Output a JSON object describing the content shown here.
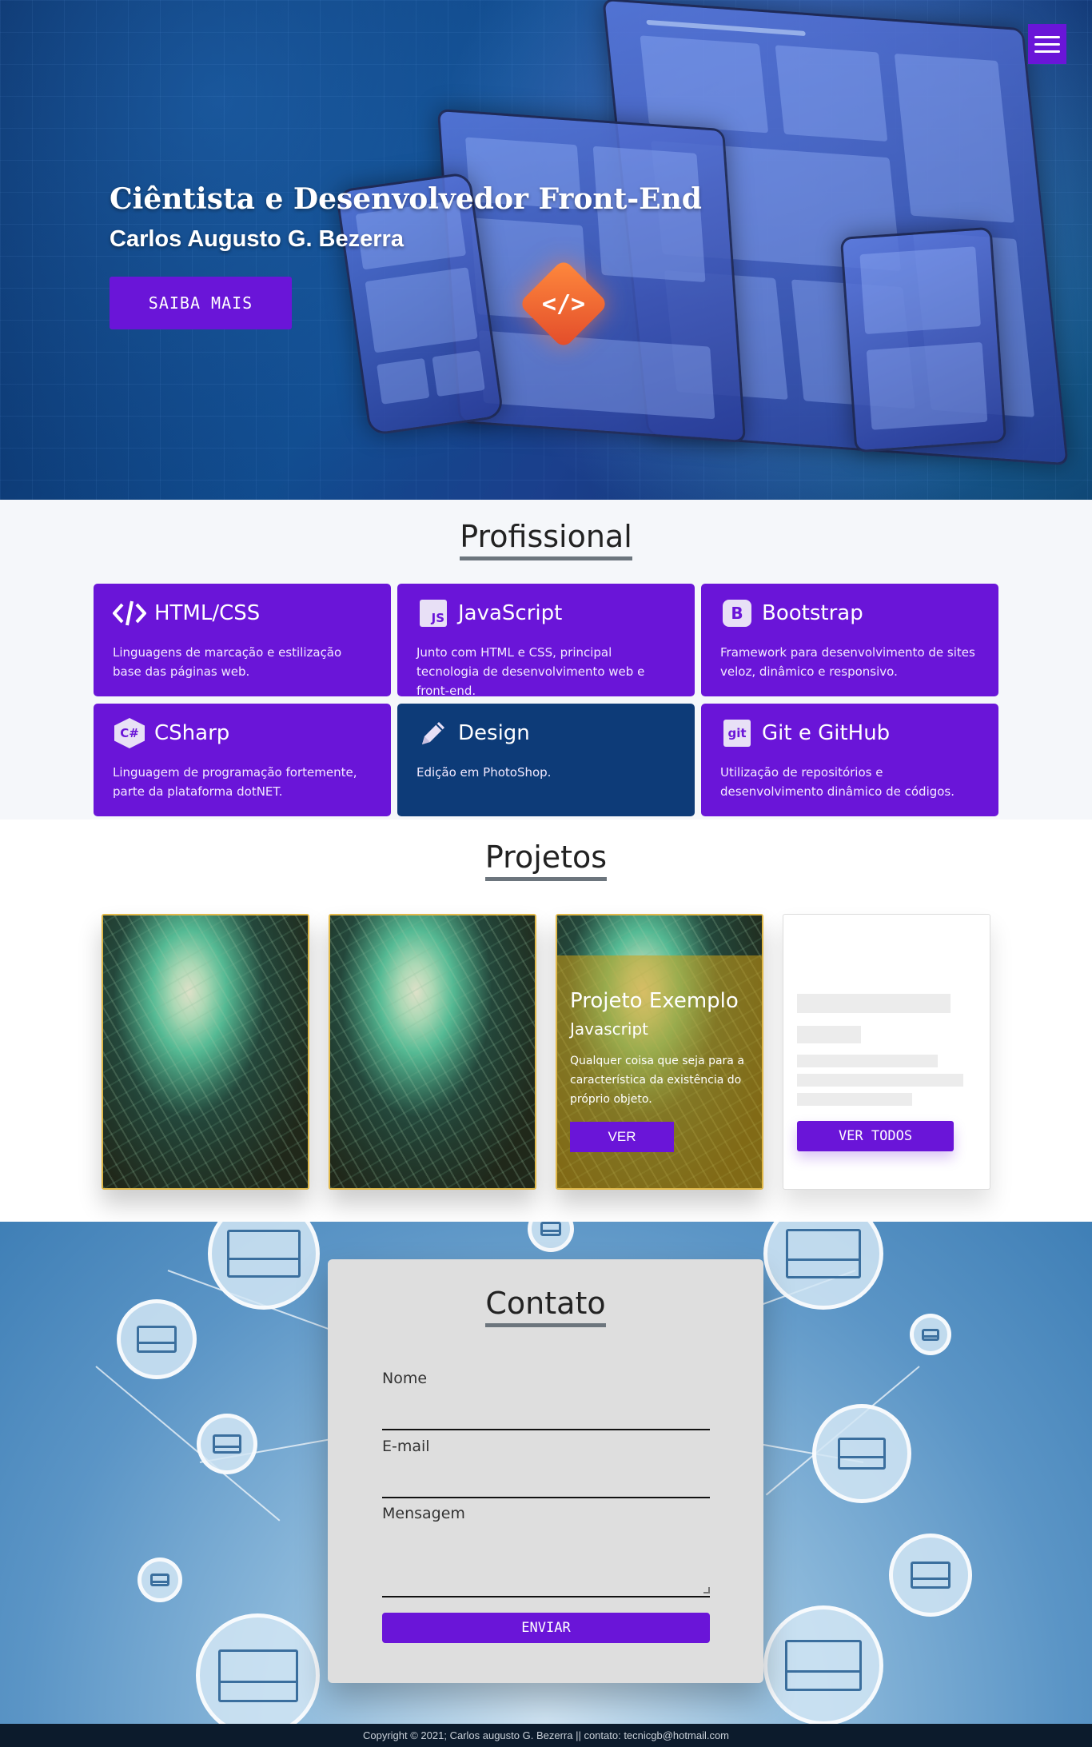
{
  "hero": {
    "title": "Ciêntista e Desenvolvedor Front-End",
    "subtitle": "Carlos Augusto G. Bezerra",
    "button_label": "SAIBA MAIS",
    "menu_icon": "hamburger-menu-icon",
    "badge_glyph": "</>"
  },
  "profissional": {
    "title": "Profissional",
    "cards": [
      {
        "title": "HTML/CSS",
        "icon": "code-icon",
        "description": "Linguagens de marcação e estilização base das páginas web."
      },
      {
        "title": "JavaScript",
        "icon": "js-icon",
        "description": "Junto com HTML e CSS, principal tecnologia de desenvolvimento web e front-end."
      },
      {
        "title": "Bootstrap",
        "icon": "bootstrap-icon",
        "description": "Framework para desenvolvimento de sites veloz, dinâmico e responsivo."
      },
      {
        "title": "CSharp",
        "icon": "csharp-icon",
        "description": "Linguagem de programação fortemente, parte da plataforma dotNET."
      },
      {
        "title": "Design",
        "icon": "pencil-icon",
        "description": "Edição em PhotoShop."
      },
      {
        "title": "Git e GitHub",
        "icon": "git-icon",
        "description": "Utilização de repositórios e desenvolvimento dinâmico de códigos."
      }
    ],
    "icon_glyphs": {
      "js": "JS",
      "bootstrap": "B",
      "csharp": "C#",
      "git": "git"
    }
  },
  "projetos": {
    "title": "Projetos",
    "featured": {
      "title": "Projeto Exemplo",
      "subtitle": "Javascript",
      "description": "Qualquer coisa que seja para a característica da existência do próprio objeto.",
      "button_label": "VER"
    },
    "view_all_label": "VER TODOS"
  },
  "contato": {
    "title": "Contato",
    "name_label": "Nome",
    "email_label": "E-mail",
    "message_label": "Mensagem",
    "send_label": "ENVIAR"
  },
  "footer": {
    "text": "Copyright © 2021; Carlos augusto G. Bezerra || contato: tecnicgb@hotmail.com"
  },
  "colors": {
    "accent": "#6a15d8",
    "design_card": "#0d3b78",
    "footer_bg": "#0c1b2c"
  }
}
